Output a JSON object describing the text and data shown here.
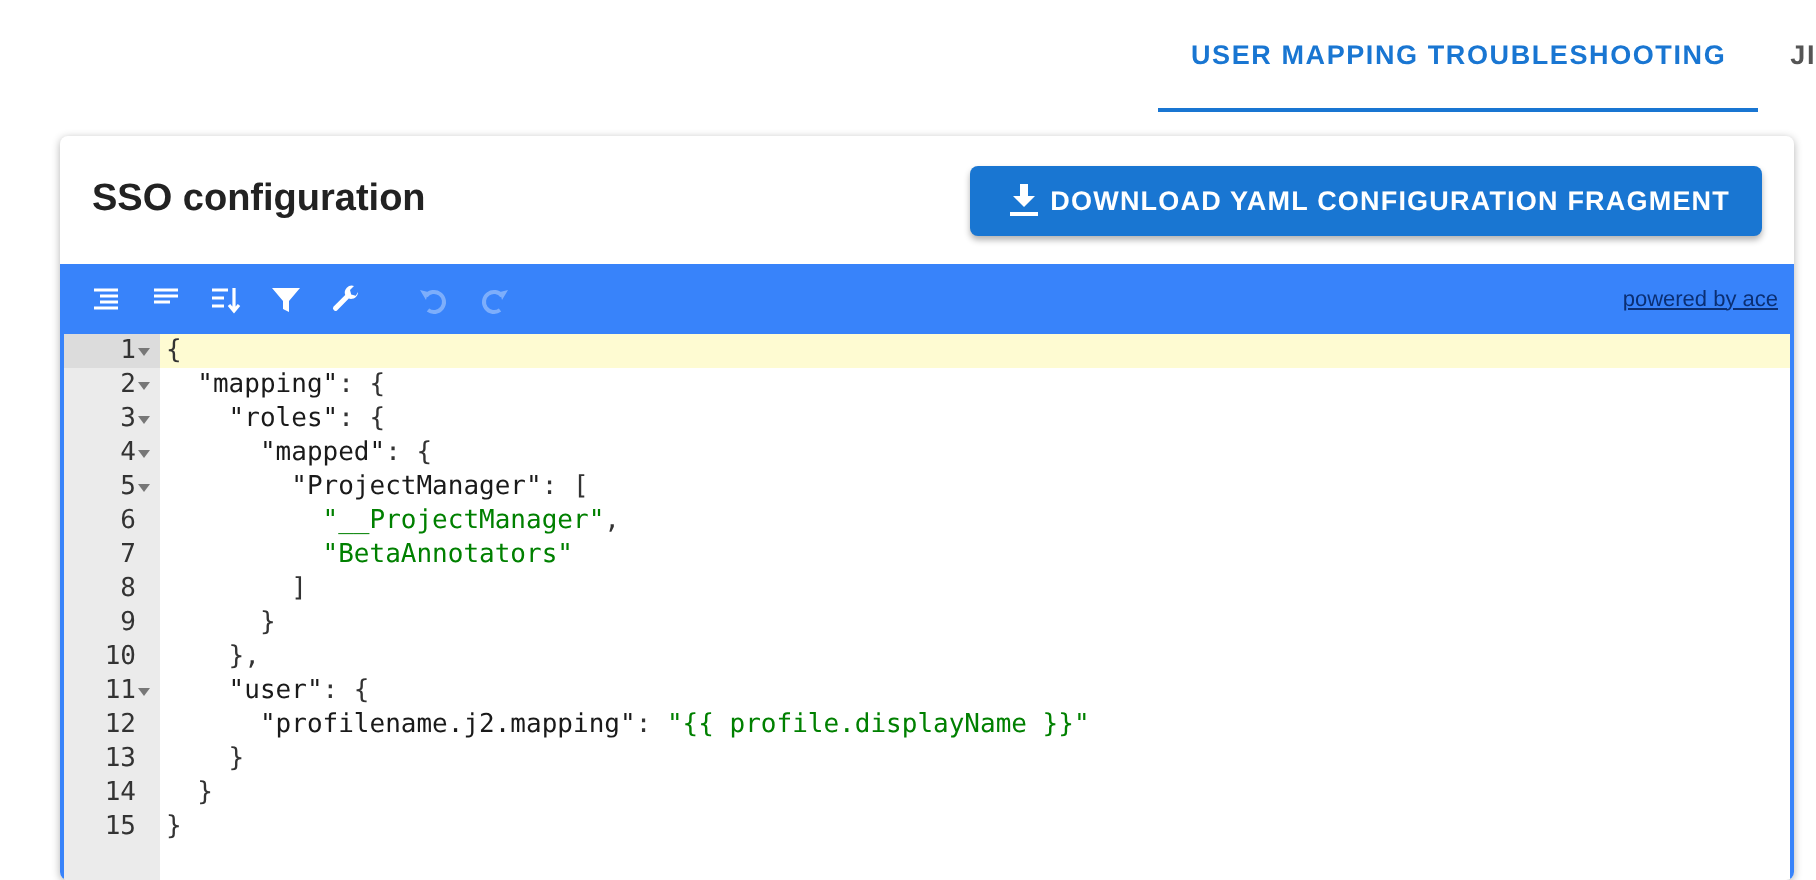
{
  "tabs": [
    {
      "label": "USER MAPPING TROUBLESHOOTING",
      "selected": true
    },
    {
      "label": "JI",
      "selected": false
    }
  ],
  "card": {
    "title": "SSO configuration",
    "download_button": "DOWNLOAD YAML CONFIGURATION FRAGMENT"
  },
  "editor": {
    "toolbar": [
      {
        "kind": "format",
        "disabled": false
      },
      {
        "kind": "compact",
        "disabled": false
      },
      {
        "kind": "sort",
        "disabled": false
      },
      {
        "kind": "filter",
        "disabled": false
      },
      {
        "kind": "repair",
        "disabled": false
      },
      {
        "kind": "undo",
        "disabled": true
      },
      {
        "kind": "redo",
        "disabled": true
      }
    ],
    "powered_by": "powered by ace",
    "lines": [
      {
        "number": "1",
        "foldable": true,
        "active": true,
        "tokens": [
          {
            "kind": "punct",
            "text": "{"
          }
        ]
      },
      {
        "number": "2",
        "foldable": true,
        "active": false,
        "tokens": [
          {
            "kind": "key",
            "text": "  \"mapping\""
          },
          {
            "kind": "punct",
            "text": ": {"
          }
        ]
      },
      {
        "number": "3",
        "foldable": true,
        "active": false,
        "tokens": [
          {
            "kind": "key",
            "text": "    \"roles\""
          },
          {
            "kind": "punct",
            "text": ": {"
          }
        ]
      },
      {
        "number": "4",
        "foldable": true,
        "active": false,
        "tokens": [
          {
            "kind": "key",
            "text": "      \"mapped\""
          },
          {
            "kind": "punct",
            "text": ": {"
          }
        ]
      },
      {
        "number": "5",
        "foldable": true,
        "active": false,
        "tokens": [
          {
            "kind": "key",
            "text": "        \"ProjectManager\""
          },
          {
            "kind": "punct",
            "text": ": ["
          }
        ]
      },
      {
        "number": "6",
        "foldable": false,
        "active": false,
        "tokens": [
          {
            "kind": "string",
            "text": "          \"__ProjectManager\""
          },
          {
            "kind": "punct",
            "text": ","
          }
        ]
      },
      {
        "number": "7",
        "foldable": false,
        "active": false,
        "tokens": [
          {
            "kind": "string",
            "text": "          \"BetaAnnotators\""
          }
        ]
      },
      {
        "number": "8",
        "foldable": false,
        "active": false,
        "tokens": [
          {
            "kind": "punct",
            "text": "        ]"
          }
        ]
      },
      {
        "number": "9",
        "foldable": false,
        "active": false,
        "tokens": [
          {
            "kind": "punct",
            "text": "      }"
          }
        ]
      },
      {
        "number": "10",
        "foldable": false,
        "active": false,
        "tokens": [
          {
            "kind": "punct",
            "text": "    },"
          }
        ]
      },
      {
        "number": "11",
        "foldable": true,
        "active": false,
        "tokens": [
          {
            "kind": "key",
            "text": "    \"user\""
          },
          {
            "kind": "punct",
            "text": ": {"
          }
        ]
      },
      {
        "number": "12",
        "foldable": false,
        "active": false,
        "tokens": [
          {
            "kind": "key",
            "text": "      \"profilename.j2.mapping\""
          },
          {
            "kind": "punct",
            "text": ": "
          },
          {
            "kind": "string",
            "text": "\"{{ profile.displayName }}\""
          }
        ]
      },
      {
        "number": "13",
        "foldable": false,
        "active": false,
        "tokens": [
          {
            "kind": "punct",
            "text": "    }"
          }
        ]
      },
      {
        "number": "14",
        "foldable": false,
        "active": false,
        "tokens": [
          {
            "kind": "punct",
            "text": "  }"
          }
        ]
      },
      {
        "number": "15",
        "foldable": false,
        "active": false,
        "tokens": [
          {
            "kind": "punct",
            "text": "}"
          }
        ]
      }
    ]
  }
}
